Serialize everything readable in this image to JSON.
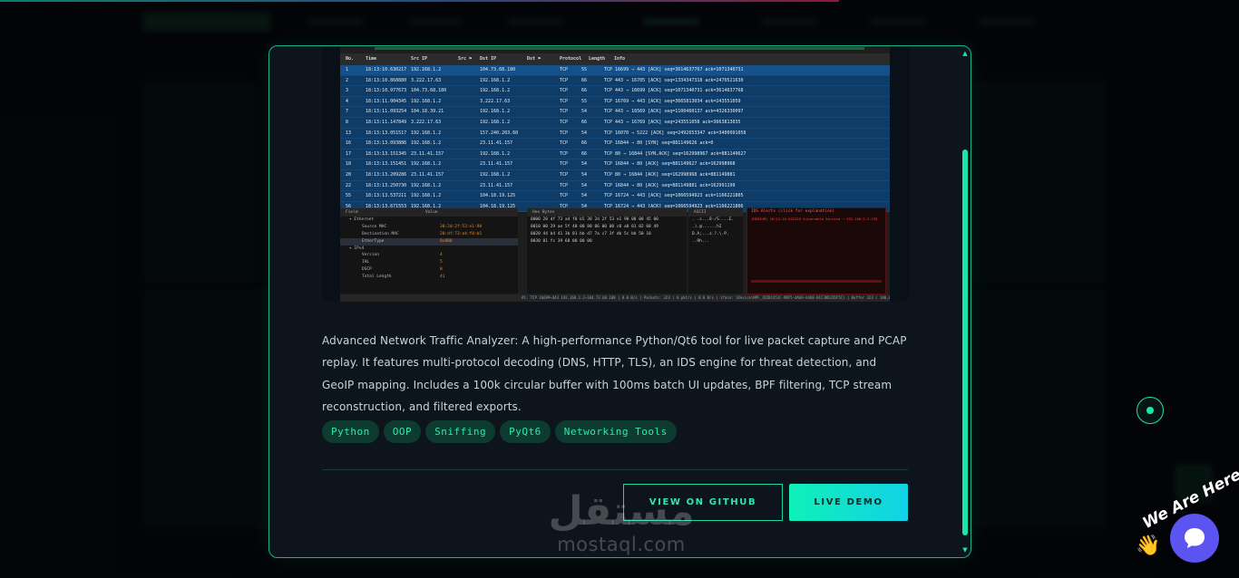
{
  "packet_table": {
    "headers": [
      "No.",
      "Time",
      "Src IP",
      "Src ⚑",
      "Dst IP",
      "Dst ⚑",
      "Protocol",
      "Length",
      "Info"
    ],
    "rows": [
      [
        "1",
        "18:13:10.630217",
        "192.168.1.2",
        "104.73.68.180",
        "TCP",
        "55",
        "TCP 16699 → 443  [ACK]  seq=3614637767  ack=1071340731"
      ],
      [
        "2",
        "18:13:10.868880",
        "3.222.17.63",
        "192.168.1.2",
        "TCP",
        "66",
        "TCP 443 → 16705  [ACK]  seq=1334347318  ack=2470521630"
      ],
      [
        "3",
        "18:13:10.977673",
        "104.73.68.180",
        "192.168.1.2",
        "TCP",
        "66",
        "TCP 443 → 16699  [ACK]  seq=1071340731  ack=3614637768"
      ],
      [
        "4",
        "18:13:11.004345",
        "192.168.1.2",
        "3.222.17.63",
        "TCP",
        "55",
        "TCP 16769 → 443  [ACK]  seq=3665813034  ack=243551059"
      ],
      [
        "7",
        "18:13:11.093254",
        "104.18.39.21",
        "192.168.1.2",
        "TCP",
        "54",
        "TCP 443 → 16569  [ACK]  seq=1100460137  ack=4326330097"
      ],
      [
        "8",
        "18:13:11.147849",
        "3.222.17.63",
        "192.168.1.2",
        "TCP",
        "66",
        "TCP 443 → 16769  [ACK]  seq=243551058  ack=3663813035"
      ],
      [
        "13",
        "18:13:13.051517",
        "192.168.1.2",
        "157.240.203.60",
        "TCP",
        "54",
        "TCP 16070 → 5222  [ACK]  seq=2492653347  ack=3400991058"
      ],
      [
        "16",
        "18:13:13.093886",
        "192.168.1.2",
        "23.11.41.157",
        "TCP",
        "66",
        "TCP 16844 → 80  [SYN]  seq=881149626  ack=0"
      ],
      [
        "17",
        "18:13:13.151345",
        "23.11.41.157",
        "192.168.1.2",
        "TCP",
        "66",
        "TCP 80 → 16844  [SYN,ACK]  seq=162998967  ack=881149627"
      ],
      [
        "18",
        "18:13:13.151451",
        "192.168.1.2",
        "23.11.41.157",
        "TCP",
        "54",
        "TCP 16844 → 80  [ACK]  seq=881149627  ack=162998968"
      ],
      [
        "20",
        "18:13:13.209286",
        "23.11.41.157",
        "192.168.1.2",
        "TCP",
        "54",
        "TCP 80 → 16844  [ACK]  seq=162998968  ack=881149881"
      ],
      [
        "22",
        "18:13:13.250730",
        "192.168.1.2",
        "23.11.41.157",
        "TCP",
        "54",
        "TCP 16844 → 80  [ACK]  seq=881149881  ack=162991199"
      ],
      [
        "55",
        "18:13:13.537211",
        "192.168.1.2",
        "104.18.19.125",
        "TCP",
        "54",
        "TCP 16724 → 443  [ACK]  seq=1066594923  ack=1166221805"
      ],
      [
        "56",
        "18:13:13.671553",
        "192.168.1.2",
        "104.18.19.125",
        "TCP",
        "54",
        "TCP 16724 → 443  [ACK]  seq=1066594923  ack=1166221806"
      ]
    ]
  },
  "detail_tree": {
    "headers": [
      "Field",
      "Value"
    ],
    "rows": [
      [
        "▾ Ethernet",
        ""
      ],
      [
        "Source MAC",
        "38:2d:2f:53:e1:98"
      ],
      [
        "Destination MAC",
        "20:df:73:a4:f0:b5"
      ],
      [
        "EtherType",
        "0x800"
      ],
      [
        "▾ IPv4",
        ""
      ],
      [
        "Version",
        "4"
      ],
      [
        "IHL",
        "5"
      ],
      [
        "DSCP",
        "0"
      ],
      [
        "Total Length",
        "41"
      ]
    ]
  },
  "hex_pane": {
    "title": "Hex Bytes",
    "lines": [
      "0000  20 df 73 a4 f0 b5 38 2d 2f 53 e1 98 08 00 45 00",
      "0010  00 29 ae 5f 40 00 80 06 00 00 c0 a8 01 02 68 49",
      "0020  44 b4 41 3b 01 bb d7 7a c7 3f db 5c bb 50 10",
      "0030  01 fc 39 68 00 00 00"
    ]
  },
  "ascii_pane": {
    "title": "ASCII",
    "lines": [
      ". .s...8-/S....E.",
      ".).@......hI",
      "D.A;...z.?.\\.P.",
      "..9h..."
    ]
  },
  "ids_pane": {
    "title": "IDS Alerts (click for explanation)",
    "lines": [
      "[MEDIUM]  18:13:10.533128  Vulnerable Service → 192.168.1.2:135"
    ]
  },
  "status_bar": {
    "text": "#1: TCP  16699→443  192.168.1.2→104.73.68.180  |  0.0 B/s  |  Packets: 323  |  0 pkt/s  |  0.0 B/s  |  iface: \\Device\\NPF_{B2DC451C-9BF5-4A69-A468-01C30D32DF5C}  |  Buffer 323 / 100,000  (0%)"
  },
  "description": "Advanced Network Traffic Analyzer: A high-performance Python/Qt6 tool for live packet capture and PCAP replay. It features multi-protocol decoding (DNS, HTTP, TLS), an IDS engine for threat detection, and GeoIP mapping. Includes a 100k circular buffer with 100ms batch UI updates, BPF filtering, TCP stream reconstruction, and filtered exports.",
  "tags": [
    "Python",
    "OOP",
    "Sniffing",
    "PyQt6",
    "Networking Tools"
  ],
  "buttons": {
    "github": "VIEW ON GITHUB",
    "demo": "LIVE DEMO"
  },
  "watermark": {
    "arabic": "مستقل",
    "latin": "mostaql.com"
  },
  "chat_widget": {
    "greeting": "We Are Here!",
    "wave": "👋"
  },
  "colors": {
    "accent": "#19e6a8",
    "chat": "#5b54f0",
    "modal_bg": "#0d141b"
  }
}
